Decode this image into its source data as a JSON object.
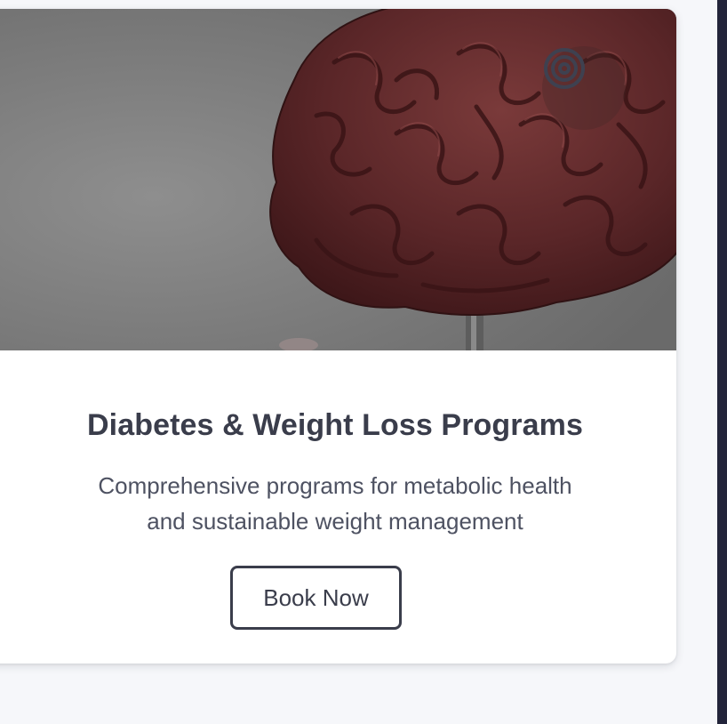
{
  "card": {
    "title": "Diabetes & Weight Loss Programs",
    "description_line1": "Comprehensive programs for metabolic health",
    "description_line2": "and sustainable weight management",
    "button_label": "Book Now",
    "image_subject": "brain-model",
    "badge_icon": "target-icon"
  },
  "colors": {
    "page_background": "#f6f7fa",
    "card_background": "#ffffff",
    "text_dark": "#3a3d4b",
    "text_muted": "#4e5262",
    "right_border": "#22243a",
    "brain": "#5a2628"
  }
}
